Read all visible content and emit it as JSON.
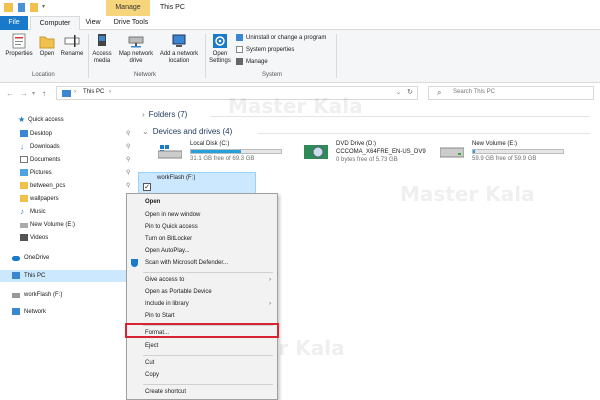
{
  "titlebar": {
    "manage": "Manage",
    "title": "This PC"
  },
  "tabs": {
    "file": "File",
    "computer": "Computer",
    "view": "View",
    "drive_tools": "Drive Tools"
  },
  "ribbon": {
    "properties": "Properties",
    "open": "Open",
    "rename": "Rename",
    "access_media_1": "Access",
    "access_media_2": "media",
    "map_network_1": "Map network",
    "map_network_2": "drive",
    "add_network_1": "Add a network",
    "add_network_2": "location",
    "open_settings_1": "Open",
    "open_settings_2": "Settings",
    "uninstall": "Uninstall or change a program",
    "system_properties": "System properties",
    "manage": "Manage",
    "group_location": "Location",
    "group_network": "Network",
    "group_system": "System"
  },
  "address": {
    "crumb": "This PC",
    "search_placeholder": "Search This PC"
  },
  "nav": {
    "quick_access": "Quick access",
    "desktop": "Desktop",
    "downloads": "Downloads",
    "documents": "Documents",
    "pictures": "Pictures",
    "between_pcs": "between_pcs",
    "wallpapers": "wallpapers",
    "music": "Music",
    "new_volume": "New Volume (E:)",
    "videos": "Videos",
    "onedrive": "OneDrive",
    "this_pc": "This PC",
    "workflash": "workFlash (F:)",
    "network": "Network"
  },
  "content": {
    "folders": "Folders (7)",
    "devices": "Devices and drives (4)",
    "drives": [
      {
        "name": "Local Disk (C:)",
        "free": "31.1 GB free of 69.3 GB",
        "used": 0.55
      },
      {
        "name": "DVD Drive (D:)",
        "label": "CCCOMA_X64FRE_EN-US_DV9",
        "free": "0 bytes free of 5.73 GB"
      },
      {
        "name": "New Volume (E:)",
        "free": "59.9 GB free of 59.9 GB",
        "used": 0.02
      },
      {
        "name": "workFlash (F:)"
      }
    ]
  },
  "context_menu": {
    "open": "Open",
    "open_new_window": "Open in new window",
    "pin_quick_access": "Pin to Quick access",
    "bitlocker": "Turn on BitLocker",
    "autoplay": "Open AutoPlay...",
    "defender": "Scan with Microsoft Defender...",
    "give_access": "Give access to",
    "portable_device": "Open as Portable Device",
    "include_library": "Include in library",
    "pin_start": "Pin to Start",
    "format": "Format...",
    "eject": "Eject",
    "cut": "Cut",
    "copy": "Copy",
    "create_shortcut": "Create shortcut"
  },
  "watermark": "Master Kala",
  "colors": {
    "accent": "#1979ca",
    "manage_tab": "#f6d57c",
    "selection": "#cce8ff",
    "highlight_box": "#d62433"
  }
}
